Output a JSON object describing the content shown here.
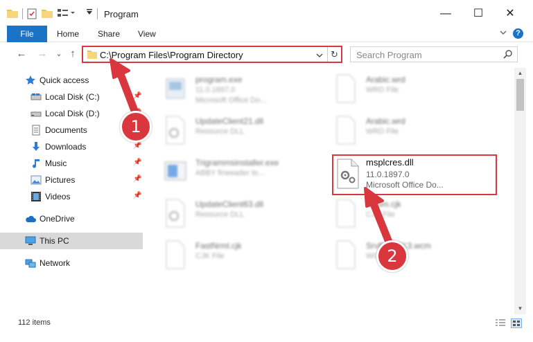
{
  "window": {
    "title": "Program",
    "controls": {
      "minimize": "—",
      "maximize": "☐",
      "close": "✕"
    }
  },
  "ribbon": {
    "file_tab": "File",
    "tabs": [
      "Home",
      "Share",
      "View"
    ],
    "expand_icon": "chevron-down-icon",
    "help": "?"
  },
  "address_bar": {
    "path": "C:\\Program Files\\Program Directory",
    "dropdown": "⌄",
    "refresh": "↻"
  },
  "search": {
    "placeholder": "Search Program"
  },
  "navigation": {
    "back": "←",
    "forward": "→",
    "recent": "⌄",
    "up": "↑"
  },
  "sidebar": {
    "items": [
      {
        "label": "Quick access",
        "icon": "star-icon",
        "pinned": false
      },
      {
        "label": "Local Disk (C:)",
        "icon": "drive-icon",
        "pinned": true
      },
      {
        "label": "Local Disk (D:)",
        "icon": "drive-icon",
        "pinned": true
      },
      {
        "label": "Documents",
        "icon": "documents-icon",
        "pinned": true
      },
      {
        "label": "Downloads",
        "icon": "download-icon",
        "pinned": true
      },
      {
        "label": "Music",
        "icon": "music-icon",
        "pinned": true
      },
      {
        "label": "Pictures",
        "icon": "pictures-icon",
        "pinned": true
      },
      {
        "label": "Videos",
        "icon": "videos-icon",
        "pinned": true
      },
      {
        "label": "OneDrive",
        "icon": "cloud-icon",
        "pinned": false
      },
      {
        "label": "This PC",
        "icon": "computer-icon",
        "pinned": false,
        "selected": true
      },
      {
        "label": "Network",
        "icon": "network-icon",
        "pinned": false
      }
    ],
    "pin_glyph": "📌"
  },
  "files": [
    {
      "name": "program.exe",
      "line1": "11.0.1897.0",
      "line2": "Microsoft Office Do...",
      "icon": "exe-icon"
    },
    {
      "name": "Arabic.wrd",
      "line1": "WRD File",
      "line2": "",
      "icon": "file-icon"
    },
    {
      "name": "UpdateClient21.dll",
      "line1": "Resource DLL",
      "line2": "",
      "icon": "dll-icon"
    },
    {
      "name": "Arabic.wrd",
      "line1": "WRD File",
      "line2": "",
      "icon": "file-icon"
    },
    {
      "name": "Trigrammsinstaller.exe",
      "line1": "ABBY fineeader to...",
      "line2": "",
      "icon": "installer-icon"
    },
    {
      "name": "UpdateClient63.dll",
      "line1": "Resource DLL",
      "line2": "",
      "icon": "dll-icon"
    },
    {
      "name": "...com.cjk",
      "line1": "CJK File",
      "line2": "",
      "icon": "file-icon"
    },
    {
      "name": "FastNrml.cjk",
      "line1": "CJK File",
      "line2": "",
      "icon": "file-icon"
    },
    {
      "name": "SrvBigMF13.wcm",
      "line1": "WCM File",
      "line2": "",
      "icon": "file-icon"
    }
  ],
  "highlighted_file": {
    "name": "msplcres.dll",
    "version": "11.0.1897.0",
    "description": "Microsoft Office Do...",
    "icon": "dll-gear-icon"
  },
  "status": {
    "item_count": "112 items"
  },
  "annotations": {
    "step1": "1",
    "step2": "2",
    "color": "#d9363e"
  },
  "colors": {
    "accent": "#1a73c4",
    "highlight": "#d9363e",
    "selected_bg": "#d9d9d9"
  }
}
